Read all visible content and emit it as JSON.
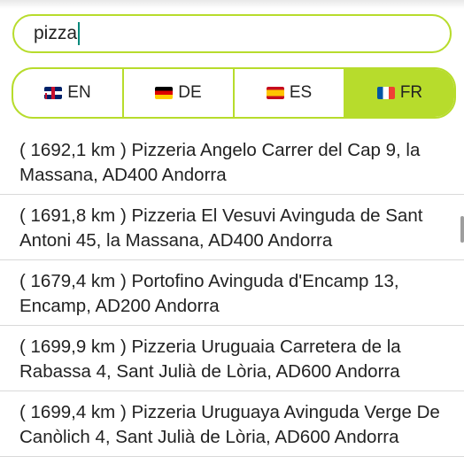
{
  "search": {
    "value": "pizza"
  },
  "languages": [
    {
      "code": "EN",
      "flag": "uk-flag-icon",
      "active": false
    },
    {
      "code": "DE",
      "flag": "germany-flag-icon",
      "active": false
    },
    {
      "code": "ES",
      "flag": "spain-flag-icon",
      "active": false
    },
    {
      "code": "FR",
      "flag": "france-flag-icon",
      "active": true
    }
  ],
  "results": [
    {
      "text": "( 1692,1 km ) Pizzeria Angelo Carrer del Cap 9, la Massana, AD400 Andorra"
    },
    {
      "text": "( 1691,8 km ) Pizzeria El Vesuvi Avinguda de Sant Antoni 45, la Massana, AD400 Andorra"
    },
    {
      "text": "( 1679,4 km ) Portofino Avinguda d'Encamp 13, Encamp, AD200 Andorra"
    },
    {
      "text": "( 1699,9 km ) Pizzeria Uruguaia Carretera de la Rabassa 4, Sant Julià de Lòria, AD600 Andorra"
    },
    {
      "text": "( 1699,4 km ) Pizzeria Uruguaya Avinguda Verge De Canòlich 4, Sant Julià de Lòria, AD600 Andorra"
    }
  ],
  "colors": {
    "accent": "#b7dc2c",
    "caret": "#00897b"
  }
}
